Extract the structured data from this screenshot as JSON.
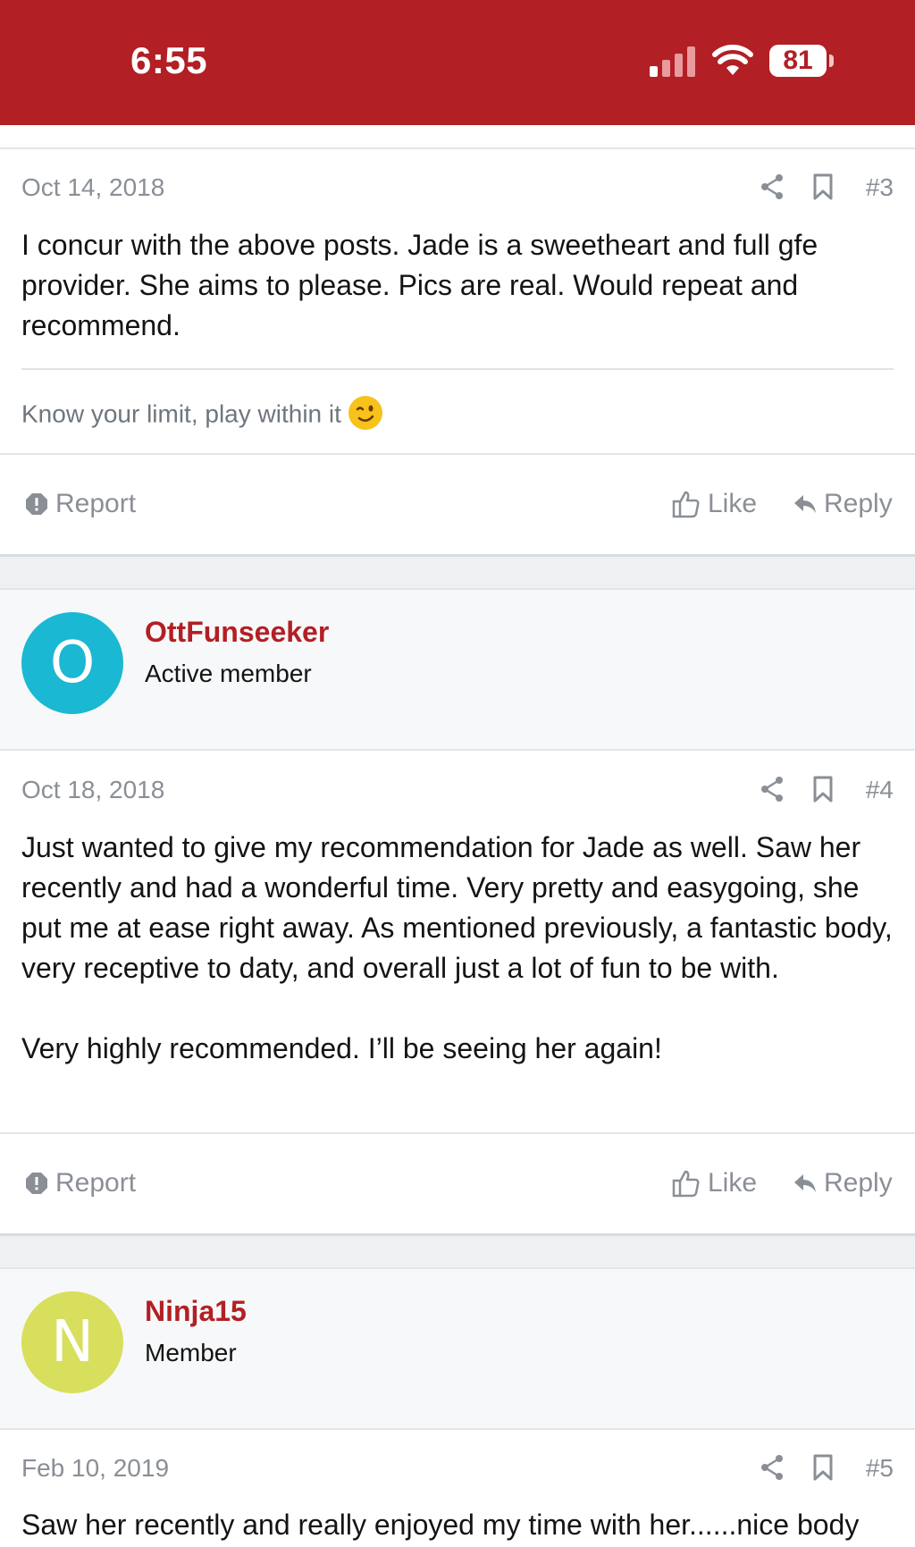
{
  "status_bar": {
    "time": "6:55",
    "battery": "81"
  },
  "posts": [
    {
      "date": "Oct 14, 2018",
      "number": "#3",
      "paragraphs": [
        "I concur with the above posts. Jade is a sweetheart and full gfe provider. She aims to please. Pics are real. Would repeat and recommend."
      ],
      "signature": "Know your limit, play within it",
      "signature_emoji": "winking-face-emoji"
    },
    {
      "author": "OttFunseeker",
      "author_title": "Active member",
      "avatar_letter": "O",
      "avatar_color": "#1ab8d2",
      "date": "Oct 18, 2018",
      "number": "#4",
      "paragraphs": [
        "Just wanted to give my recommendation for Jade as well. Saw her recently and had a wonderful time. Very pretty and easygoing, she put me at ease right away. As mentioned previously, a fantastic body, very receptive to daty, and overall just a lot of fun to be with.",
        "Very highly recommended. I’ll be seeing her again!"
      ]
    },
    {
      "author": "Ninja15",
      "author_title": "Member",
      "avatar_letter": "N",
      "avatar_color": "#d7df5c",
      "date": "Feb 10, 2019",
      "number": "#5",
      "paragraphs": [
        "Saw her recently and really enjoyed my time with her......nice body"
      ]
    }
  ],
  "actions": {
    "report": "Report",
    "like": "Like",
    "reply": "Reply"
  },
  "colors": {
    "brand": "#b21f24",
    "muted_text": "#8a8f96"
  }
}
